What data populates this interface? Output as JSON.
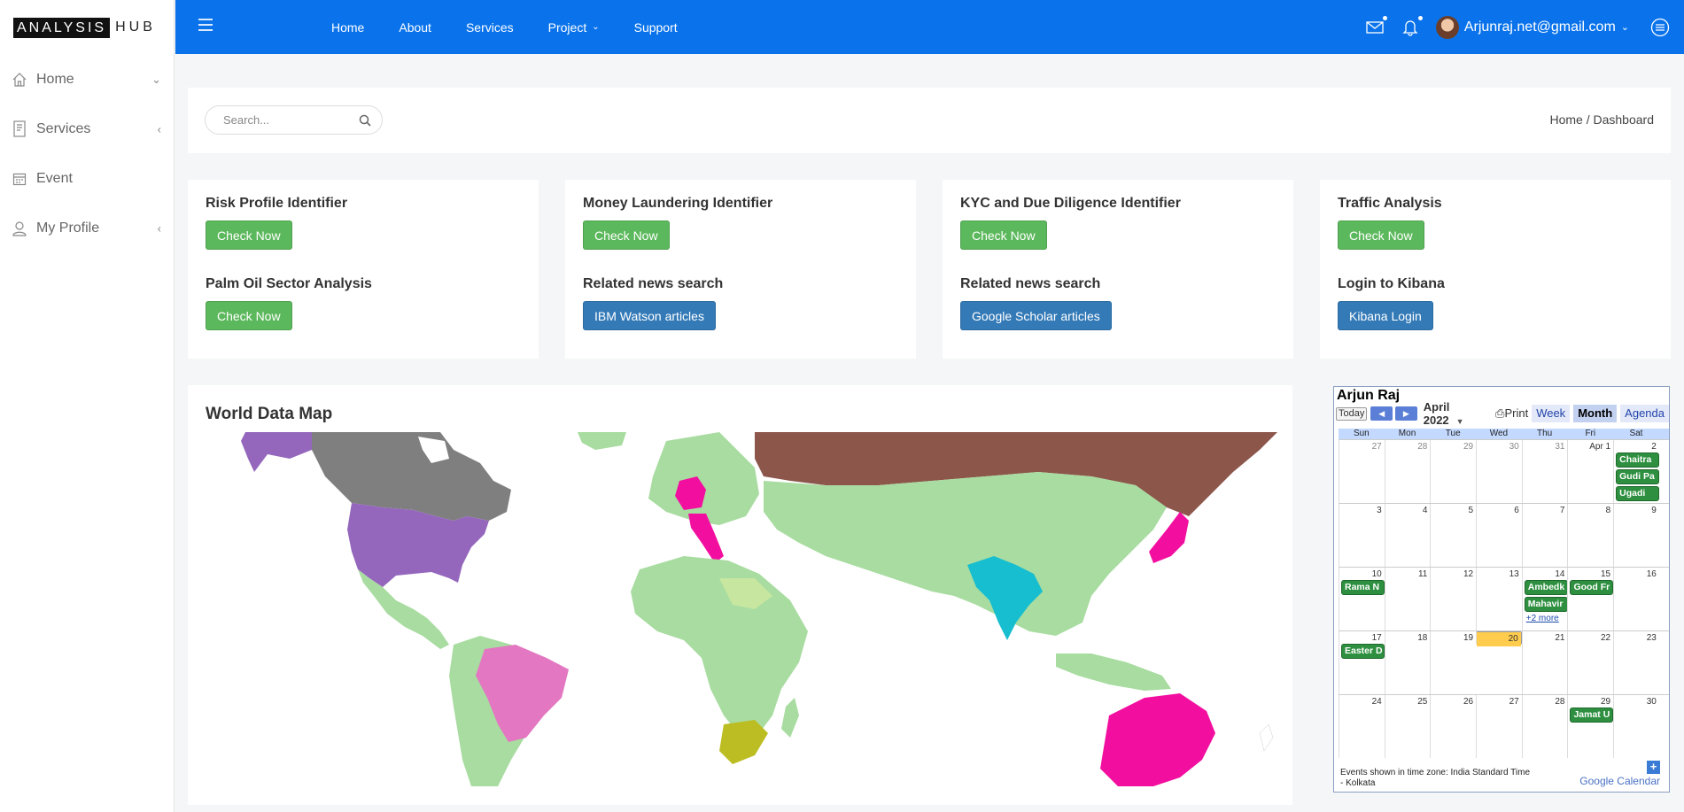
{
  "brand": {
    "part1": "ANALYSIS",
    "part2": "HUB"
  },
  "sidebar": {
    "items": [
      {
        "label": "Home",
        "icon": "home-icon",
        "arrow": "chevron-down"
      },
      {
        "label": "Services",
        "icon": "document-icon",
        "arrow": "chevron-left"
      },
      {
        "label": "Event",
        "icon": "calendar-icon",
        "arrow": ""
      },
      {
        "label": "My Profile",
        "icon": "user-icon",
        "arrow": "chevron-left"
      }
    ]
  },
  "topnav": {
    "items": [
      "Home",
      "About",
      "Services",
      "Project",
      "Support"
    ],
    "user": "Arjunraj.net@gmail.com"
  },
  "search": {
    "placeholder": "Search..."
  },
  "breadcrumb": "Home / Dashboard",
  "tools": [
    {
      "title1": "Risk Profile Identifier",
      "btn1": "Check Now",
      "title2": "Palm Oil Sector Analysis",
      "btn2": "Check Now"
    },
    {
      "title1": "Money Laundering Identifier",
      "btn1": "Check Now",
      "title2": "Related news search",
      "btn2": "IBM Watson articles"
    },
    {
      "title1": "KYC and Due Diligence Identifier",
      "btn1": "Check Now",
      "title2": "Related news search",
      "btn2": "Google Scholar articles"
    },
    {
      "title1": "Traffic Analysis",
      "btn1": "Check Now",
      "title2": "Login to Kibana",
      "btn2": "Kibana Login"
    }
  ],
  "map": {
    "title": "World Data Map"
  },
  "calendar": {
    "owner": "Arjun Raj",
    "today_label": "Today",
    "month": "April 2022",
    "print": "Print",
    "tabs": [
      "Week",
      "Month",
      "Agenda"
    ],
    "days": [
      "Sun",
      "Mon",
      "Tue",
      "Wed",
      "Thu",
      "Fri",
      "Sat"
    ],
    "weeks": [
      [
        "27",
        "28",
        "29",
        "30",
        "31",
        "Apr 1",
        "2"
      ],
      [
        "3",
        "4",
        "5",
        "6",
        "7",
        "8",
        "9"
      ],
      [
        "10",
        "11",
        "12",
        "13",
        "14",
        "15",
        "16"
      ],
      [
        "17",
        "18",
        "19",
        "20",
        "21",
        "22",
        "23"
      ],
      [
        "24",
        "25",
        "26",
        "27",
        "28",
        "29",
        "30"
      ]
    ],
    "events": {
      "sat2": [
        "Chaitra",
        "Gudi Pa",
        "Ugadi"
      ],
      "sun10": "Rama N",
      "thu14": [
        "Ambedk",
        "Mahavir"
      ],
      "thu14_more": "+2 more",
      "fri15": "Good Fr",
      "sun17": "Easter D",
      "fri29": "Jamat U"
    },
    "footer": "Events shown in time zone: India Standard Time - Kolkata",
    "gcal": "Google Calendar"
  },
  "colors": {
    "topbar": "#0a73eb",
    "green": "#5cb85c",
    "blue": "#337ab7"
  }
}
